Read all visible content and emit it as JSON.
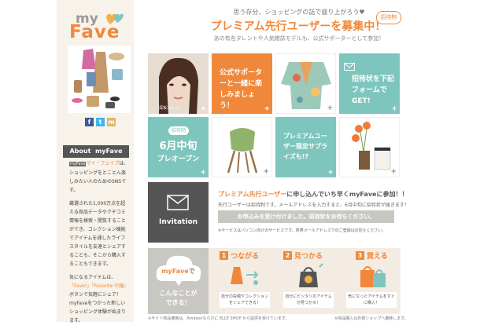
{
  "colors": {
    "orange": "#f0883b",
    "teal": "#7ec6bd",
    "gray": "#c9c7c2",
    "dark": "#555555",
    "tan": "#f4ece2"
  },
  "logo": {
    "my": "my",
    "fave": "Fave"
  },
  "header": {
    "tagline": "思う存分、ショッピングの話で盛り上がろう♥",
    "title": "プレミアム先行ユーザーを募集中！",
    "badge": "招待制",
    "subtitle": "あの有名タレントや人気雑誌モデルも、公式サポーターとして参加！"
  },
  "social": {
    "facebook": "f",
    "twitter": "t",
    "mixi": "m"
  },
  "about": {
    "heading": "About  myFave",
    "p1_brand": "myFave",
    "p1_link": "マイ・フェイブ",
    "p1_rest": "は、ショッピングをとことん楽しみたい人のためのSNSです。",
    "p2": "厳選された1,000万点を超える商品データやクチコミ情報を検索・閲覧することができ、コレクション機能でアイテムを通したライフスタイルを友達とシェアすることも、そこから購入することもできます。",
    "p3_a": "気になるアイテムは、",
    "p3_link": "「Fave!」「Favorite の鐘」",
    "p3_b": "ボタンで気軽にシェア！",
    "p3_c": "myFaveをつかった新しいショッピング体験が始まります。"
  },
  "tiles": {
    "model_name": "深坂カレン",
    "supporter": "公式サポーターと一緒に楽しみましょう！",
    "invite": "招待状を下記フォームでGET!",
    "open_badge": "招待制",
    "open_date": "6月中旬",
    "open_text": "プレオープン",
    "premium": "プレミアムユーザー限定サプライズも!?"
  },
  "invitation": {
    "label": "Invitation",
    "title_orange": "プレミアム先行ユーザー",
    "title_rest": "に申し込んでいち早くmyFaveに参加！！",
    "desc": "先行ユーザーは招待制です。メールアドレスを入力すると、6月中旬に招待状が届きます！",
    "button": "お申込みを受け付けました。招待状をお待ちください。",
    "note": "※サービスはパソコン向けのサービスです。携帯メールアドレスでのご登録はお控えください。"
  },
  "features": {
    "can_do_brand": "myFave",
    "can_do_de": "で",
    "can_do_line1": "こんなことが",
    "can_do_line2": "できる！",
    "f1_num": "1",
    "f1_title": "つながる",
    "f1_desc": "自分の投稿やコレクションをシェアできる！",
    "f2_num": "2",
    "f2_title": "見つかる",
    "f2_desc": "自分にピッタリのアイテムが見つかる！",
    "f3_num": "3",
    "f3_title": "買える",
    "f3_desc": "気になったアイテムをすぐに購入！"
  },
  "footer": {
    "left": "※サイト商品価格は、Amazonならびに ELLE SHOP から提供を受けています。",
    "right": "※商品購入は外部ショップへ遷移します。"
  }
}
